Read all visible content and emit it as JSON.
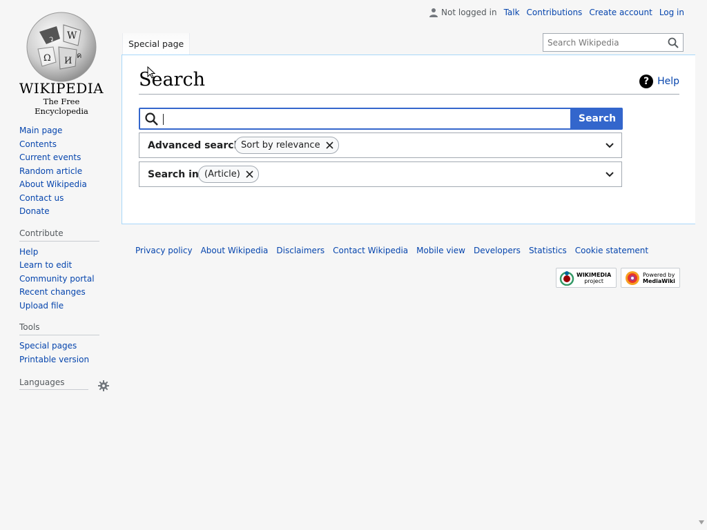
{
  "logo": {
    "wordmark": "WIKIPEDIA",
    "tagline": "The Free Encyclopedia"
  },
  "sidebar": {
    "navigation": [
      "Main page",
      "Contents",
      "Current events",
      "Random article",
      "About Wikipedia",
      "Contact us",
      "Donate"
    ],
    "contribute": {
      "heading": "Contribute",
      "items": [
        "Help",
        "Learn to edit",
        "Community portal",
        "Recent changes",
        "Upload file"
      ]
    },
    "tools": {
      "heading": "Tools",
      "items": [
        "Special pages",
        "Printable version"
      ]
    },
    "languages": {
      "heading": "Languages"
    }
  },
  "personal": {
    "status": "Not logged in",
    "links": [
      "Talk",
      "Contributions",
      "Create account",
      "Log in"
    ]
  },
  "tabs": {
    "special": "Special page"
  },
  "header_search": {
    "placeholder": "Search Wikipedia"
  },
  "main": {
    "title": "Search",
    "help": "Help",
    "search": {
      "value": "",
      "button": "Search"
    },
    "advanced": {
      "label": "Advanced search:",
      "chip": "Sort by relevance"
    },
    "search_in": {
      "label": "Search in:",
      "chip": "(Article)"
    }
  },
  "footer": {
    "links": [
      "Privacy policy",
      "About Wikipedia",
      "Disclaimers",
      "Contact Wikipedia",
      "Mobile view",
      "Developers",
      "Statistics",
      "Cookie statement"
    ],
    "badges": {
      "wikimedia": [
        "WIKIMEDIA",
        "project"
      ],
      "mediawiki": [
        "Powered by",
        "MediaWiki"
      ]
    }
  },
  "colors": {
    "link": "#0645ad",
    "accent": "#3366cc",
    "border_blue": "#a7d7f9"
  }
}
